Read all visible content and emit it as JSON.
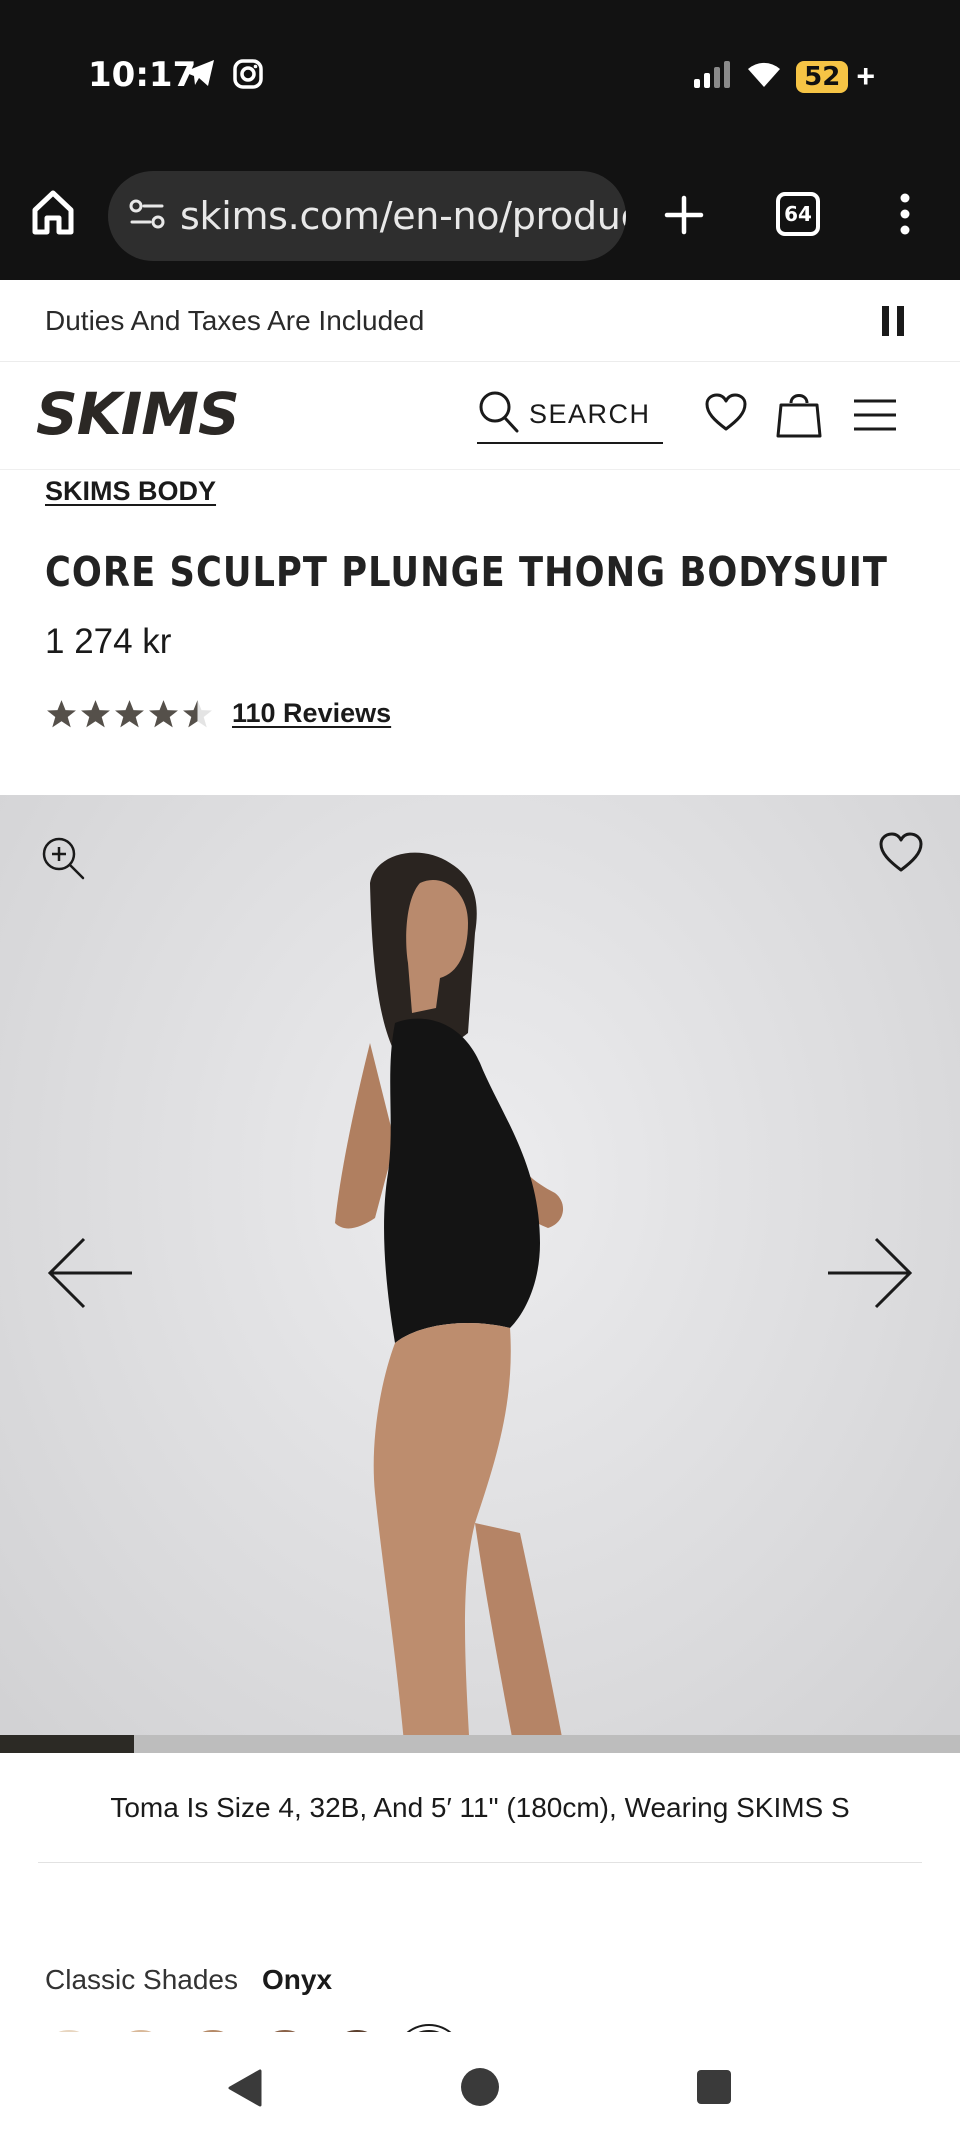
{
  "status_bar": {
    "time": "10:17",
    "battery": "52",
    "battery_suffix": "+"
  },
  "browser": {
    "url": "skims.com/en-no/products",
    "tab_count": "64"
  },
  "announcement": {
    "text": "Duties And Taxes Are Included"
  },
  "header": {
    "logo": "SKIMS",
    "search_label": "SEARCH"
  },
  "product": {
    "collection": "SKIMS BODY",
    "title": "CORE SCULPT PLUNGE THONG BODYSUIT",
    "price": "1 274 kr",
    "rating_value": 4.5,
    "rating_max": 5,
    "reviews_label": "110 Reviews"
  },
  "gallery": {
    "image_index": 1,
    "progress_fraction": 0.14,
    "caption": "Toma Is Size 4, 32B, And 5′ 11\" (180cm), Wearing SKIMS S"
  },
  "shades": {
    "label": "Classic Shades",
    "selected": "Onyx",
    "swatch_colors": [
      "#e8d6c0",
      "#d9b99a",
      "#b58a68",
      "#8a6248",
      "#5b3f2d",
      "#1f1d1b"
    ]
  },
  "colors": {
    "status_bar_bg": "#121212",
    "url_box_bg": "#2e2e2e",
    "battery_accent": "#f6c445",
    "star_color": "#55504a",
    "progress_fill": "#2c2a25"
  }
}
